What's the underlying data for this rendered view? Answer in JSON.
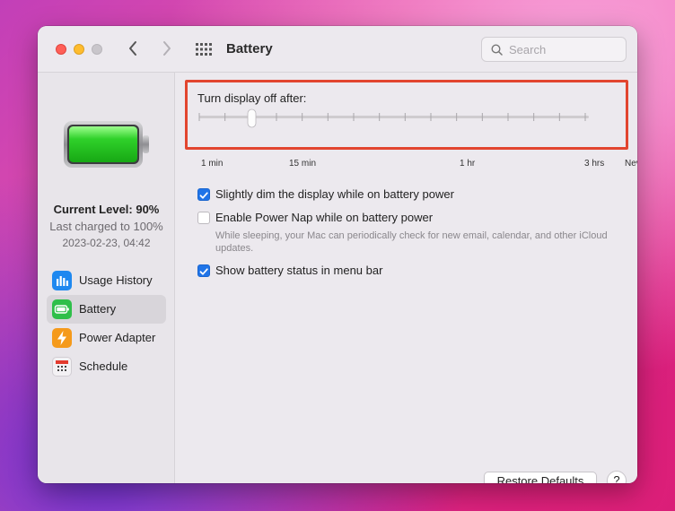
{
  "window": {
    "title": "Battery"
  },
  "search": {
    "placeholder": "Search"
  },
  "sidebar": {
    "current_level": "Current Level: 90%",
    "last_charged": "Last charged to 100%",
    "charged_date": "2023-02-23, 04:42",
    "items": [
      {
        "label": "Usage History",
        "icon": "bar-chart-icon",
        "color": "#1e88f0",
        "selected": false
      },
      {
        "label": "Battery",
        "icon": "battery-icon",
        "color": "#2fbf4a",
        "selected": true
      },
      {
        "label": "Power Adapter",
        "icon": "lightning-icon",
        "color": "#f59a1b",
        "selected": false
      },
      {
        "label": "Schedule",
        "icon": "calendar-icon",
        "color": "#e33b2f",
        "selected": false
      }
    ]
  },
  "main": {
    "turn_off_label": "Turn display off after:",
    "slider": {
      "tick_labels": [
        "1 min",
        "15 min",
        "1 hr",
        "3 hrs",
        "Never"
      ],
      "value": "2 min",
      "tick_count": 16
    },
    "options": [
      {
        "label": "Slightly dim the display while on battery power",
        "checked": true
      },
      {
        "label": "Enable Power Nap while on battery power",
        "checked": false
      },
      {
        "label": "Show battery status in menu bar",
        "checked": true
      }
    ],
    "power_nap_help": "While sleeping, your Mac can periodically check for new email, calendar, and other iCloud updates.",
    "restore_label": "Restore Defaults",
    "help_label": "?"
  },
  "colors": {
    "accent": "#1f74e8",
    "highlight_border": "#e2452f",
    "battery_fill": "#2fd12a"
  }
}
